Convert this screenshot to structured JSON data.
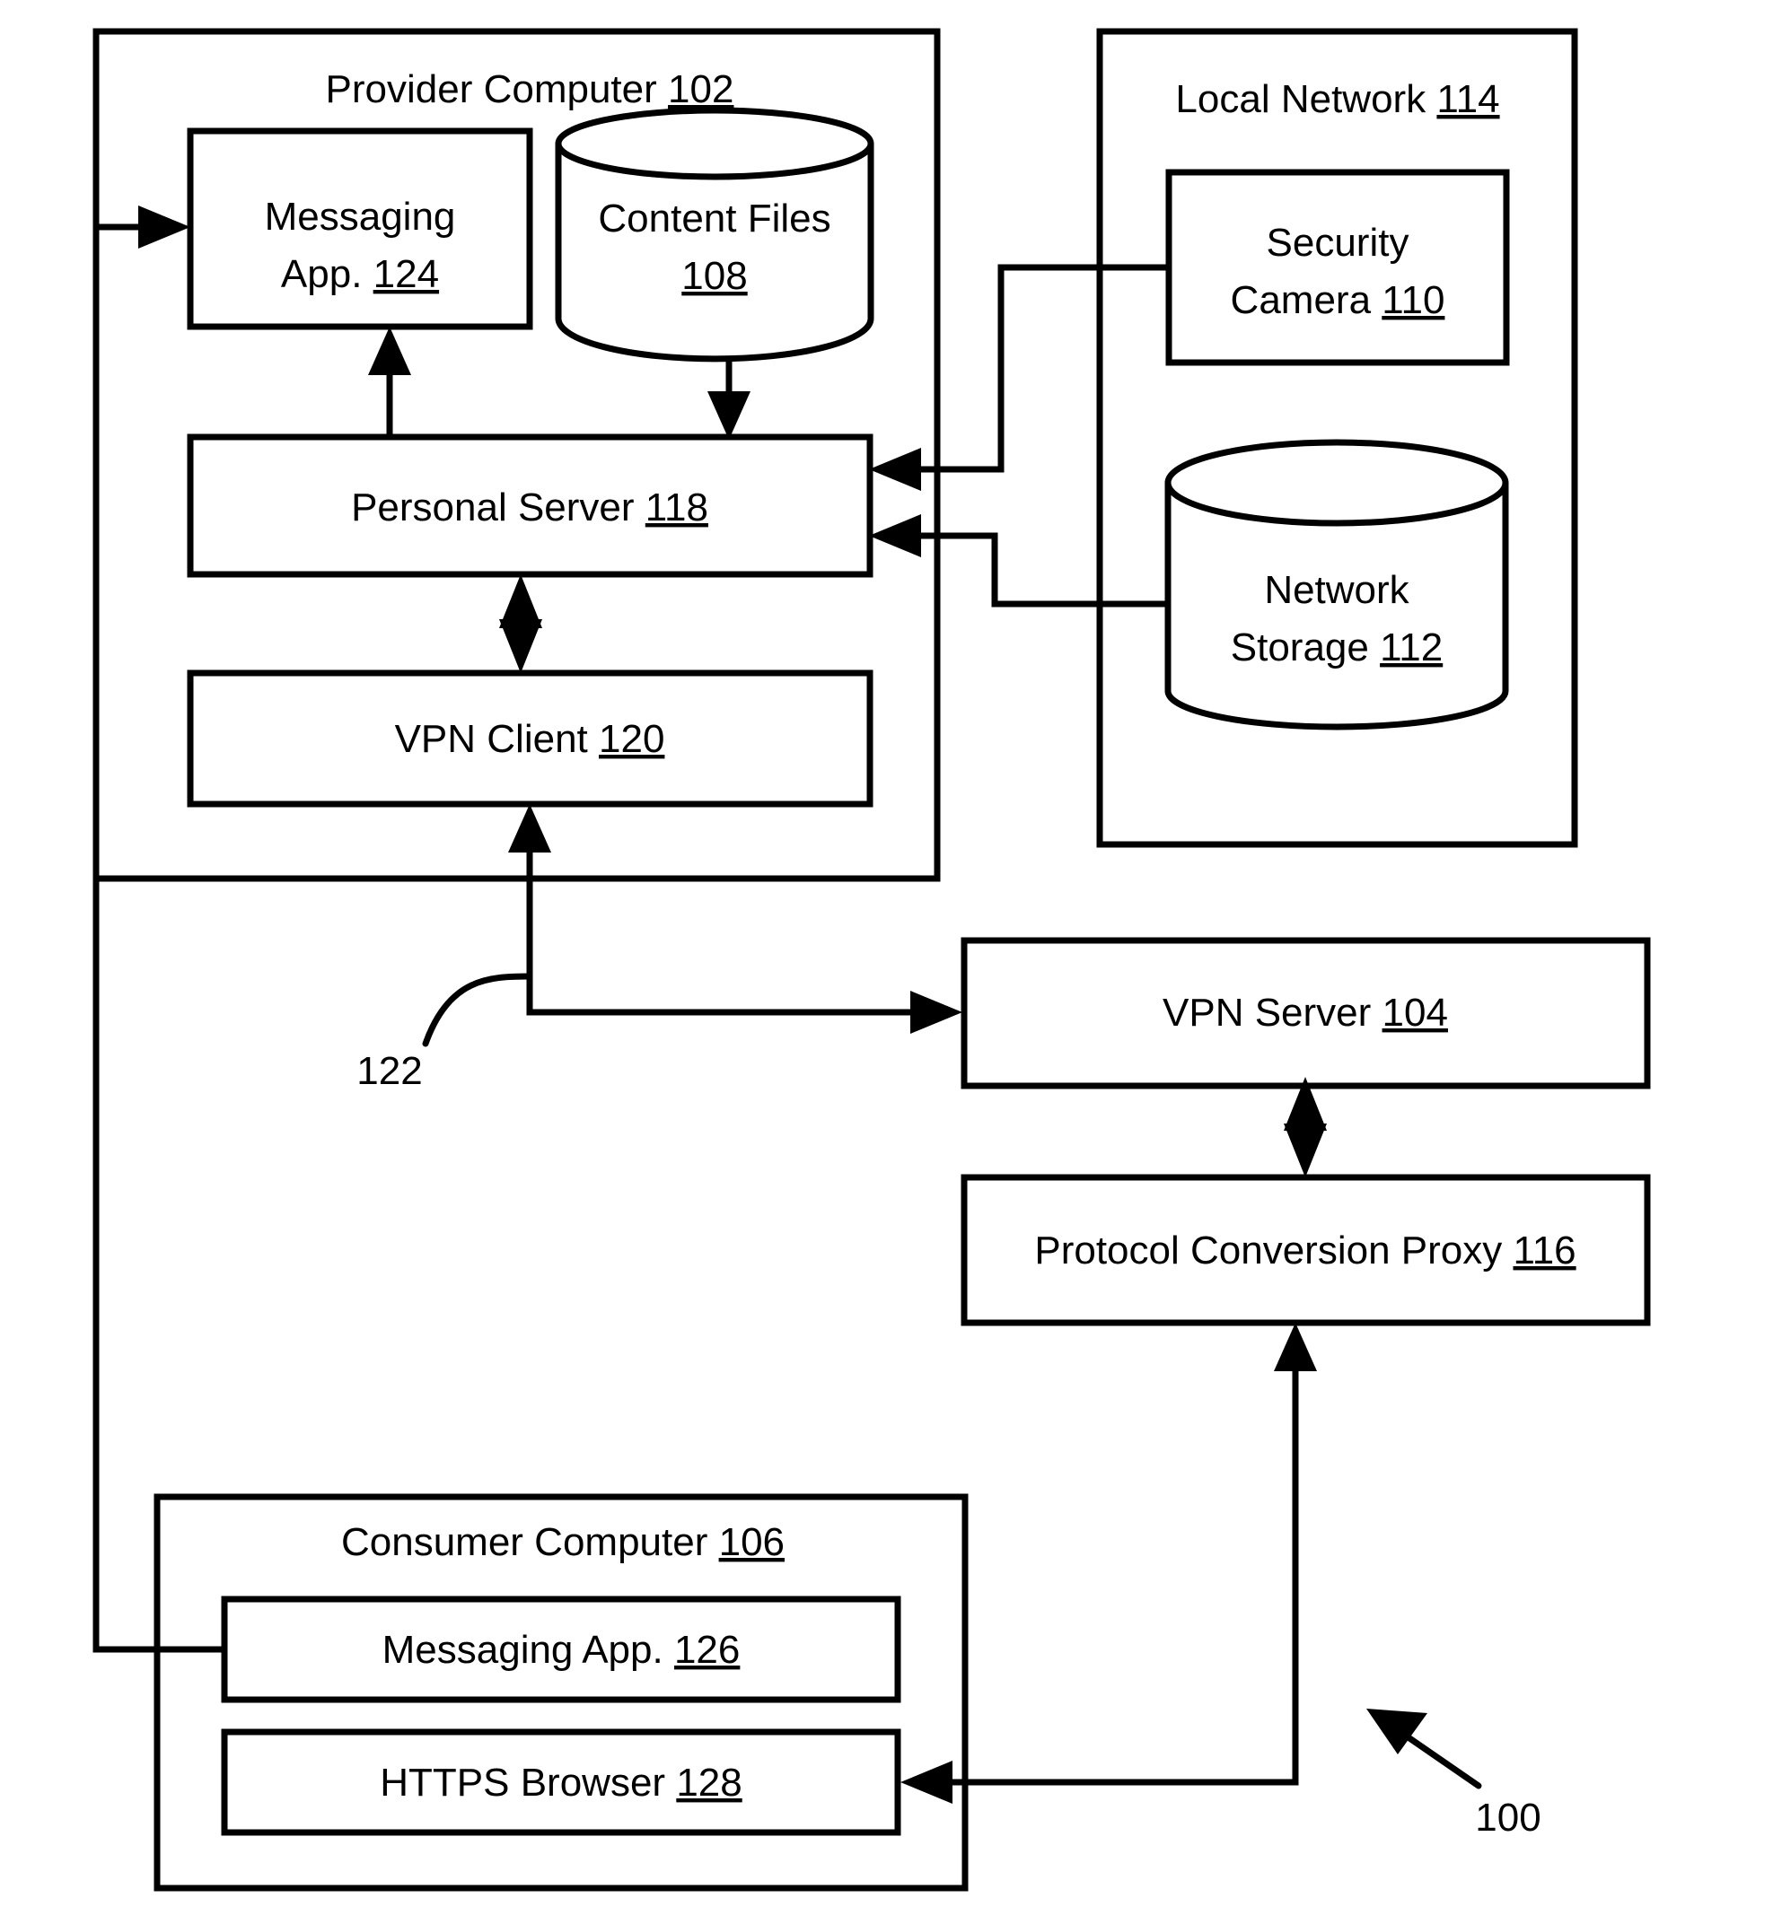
{
  "figure": {
    "figure_number_label": "100",
    "conduit_label": "122",
    "background_color": "#ffffff",
    "line_color": "#000000"
  },
  "containers": [
    {
      "id": "provider-computer",
      "title_text": "Provider Computer",
      "title_ref": "102"
    },
    {
      "id": "local-network",
      "title_text": "Local Network",
      "title_ref": "114"
    },
    {
      "id": "consumer-computer",
      "title_text": "Consumer Computer",
      "title_ref": "106"
    }
  ],
  "blocks": [
    {
      "id": "messaging-app-124",
      "line1": "Messaging",
      "line2": "App.",
      "ref": "124",
      "shape": "rect"
    },
    {
      "id": "content-files-108",
      "line1": "Content Files",
      "line2": "",
      "ref": "108",
      "shape": "cylinder"
    },
    {
      "id": "personal-server-118",
      "line1": "Personal Server",
      "line2": "",
      "ref": "118",
      "shape": "rect"
    },
    {
      "id": "vpn-client-120",
      "line1": "VPN Client",
      "line2": "",
      "ref": "120",
      "shape": "rect"
    },
    {
      "id": "security-camera-110",
      "line1": "Security",
      "line2": "Camera",
      "ref": "110",
      "shape": "rect"
    },
    {
      "id": "network-storage-112",
      "line1": "Network",
      "line2": "Storage",
      "ref": "112",
      "shape": "cylinder"
    },
    {
      "id": "vpn-server-104",
      "line1": "VPN Server",
      "line2": "",
      "ref": "104",
      "shape": "rect"
    },
    {
      "id": "protocol-conversion-proxy-116",
      "line1": "Protocol Conversion Proxy",
      "line2": "",
      "ref": "116",
      "shape": "rect"
    },
    {
      "id": "messaging-app-126",
      "line1": "Messaging App.",
      "line2": "",
      "ref": "126",
      "shape": "rect"
    },
    {
      "id": "https-browser-128",
      "line1": "HTTPS Browser",
      "line2": "",
      "ref": "128",
      "shape": "rect"
    }
  ],
  "text": {
    "provider_computer_title": "Provider Computer",
    "provider_computer_ref": "102",
    "local_network_title": "Local Network",
    "local_network_ref": "114",
    "consumer_computer_title": "Consumer Computer",
    "consumer_computer_ref": "106",
    "messaging_app_l1": "Messaging",
    "messaging_app_l2": "App.",
    "messaging_app_ref": "124",
    "content_files_l1": "Content Files",
    "content_files_ref": "108",
    "personal_server_l1": "Personal Server",
    "personal_server_ref": "118",
    "vpn_client_l1": "VPN Client",
    "vpn_client_ref": "120",
    "security_camera_l1": "Security",
    "security_camera_l2": "Camera",
    "security_camera_ref": "110",
    "network_storage_l1": "Network",
    "network_storage_l2": "Storage",
    "network_storage_ref": "112",
    "vpn_server_l1": "VPN Server",
    "vpn_server_ref": "104",
    "proxy_l1": "Protocol Conversion Proxy",
    "proxy_ref": "116",
    "consumer_messaging_l1": "Messaging App.",
    "consumer_messaging_ref": "126",
    "https_browser_l1": "HTTPS Browser",
    "https_browser_ref": "128",
    "conduit_122": "122",
    "figure_100": "100"
  }
}
